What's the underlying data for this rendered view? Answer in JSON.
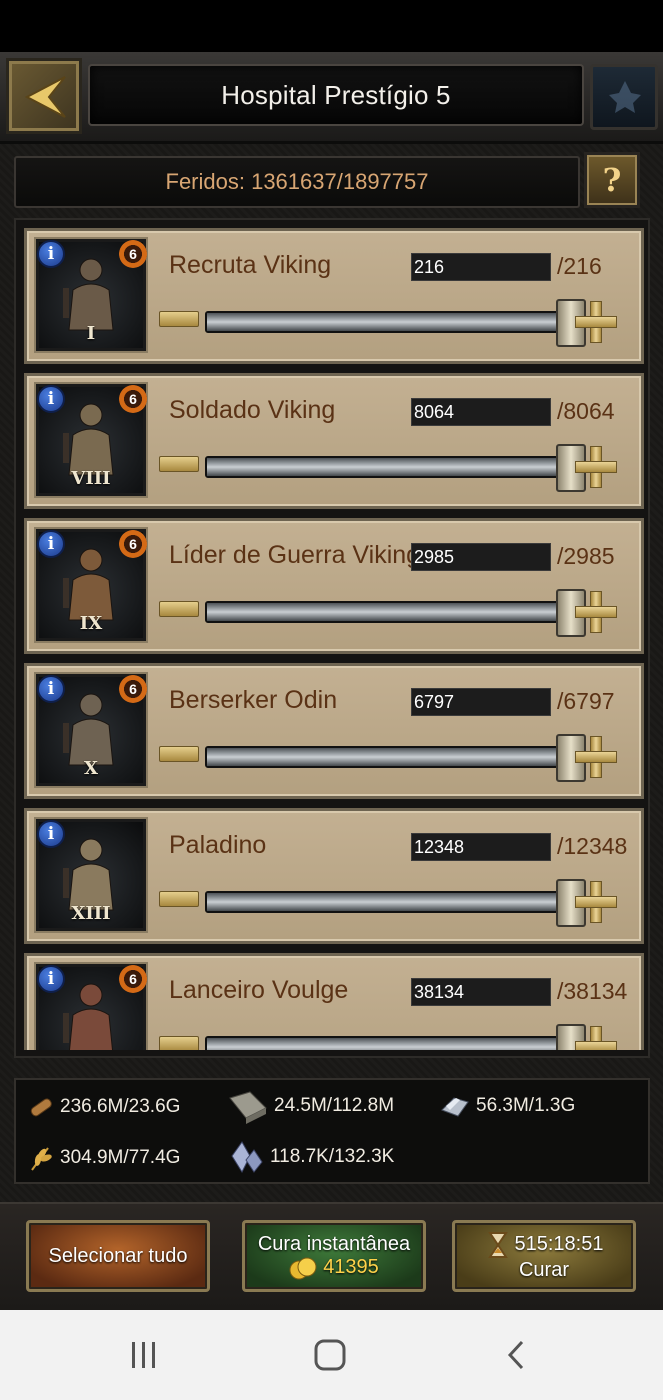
{
  "header": {
    "title": "Hospital Prestígio 5"
  },
  "wounded": {
    "text": "Feridos: 1361637/1897757",
    "help_label": "?"
  },
  "troops": [
    {
      "name": "Recruta Viking",
      "qty": "216",
      "max": "/216",
      "tier": "I",
      "rank": "6",
      "fill": 1.0
    },
    {
      "name": "Soldado Viking",
      "qty": "8064",
      "max": "/8064",
      "tier": "VIII",
      "rank": "6",
      "fill": 1.0
    },
    {
      "name": "Líder de Guerra Viking",
      "qty": "2985",
      "max": "/2985",
      "tier": "IX",
      "rank": "6",
      "fill": 1.0
    },
    {
      "name": "Berserker Odin",
      "qty": "6797",
      "max": "/6797",
      "tier": "X",
      "rank": "6",
      "fill": 1.0
    },
    {
      "name": "Paladino",
      "qty": "12348",
      "max": "/12348",
      "tier": "XIII",
      "rank": "",
      "fill": 1.0
    },
    {
      "name": "Lanceiro Voulge",
      "qty": "38134",
      "max": "/38134",
      "tier": "",
      "rank": "6",
      "fill": 1.0
    }
  ],
  "resources": {
    "wood": "236.6M/23.6G",
    "stone": "24.5M/112.8M",
    "iron": "56.3M/1.3G",
    "food": "304.9M/77.4G",
    "silver": "118.7K/132.3K"
  },
  "buttons": {
    "select_all": "Selecionar tudo",
    "instant_cure": "Cura instantânea",
    "instant_cost": "41395",
    "heal_time": "515:18:51",
    "heal": "Curar"
  },
  "icons": {
    "back": "back-arrow-icon",
    "help": "question-icon",
    "info": "info-icon",
    "wood": "wood-icon",
    "stone": "stone-icon",
    "iron": "iron-icon",
    "food": "wheat-icon",
    "silver": "silver-icon",
    "gold": "gold-coin-icon",
    "timer": "hourglass-icon"
  },
  "colors": {
    "accent_gold": "#d8a673",
    "card_bg": "#c3b092",
    "name_text": "#5a3215"
  }
}
